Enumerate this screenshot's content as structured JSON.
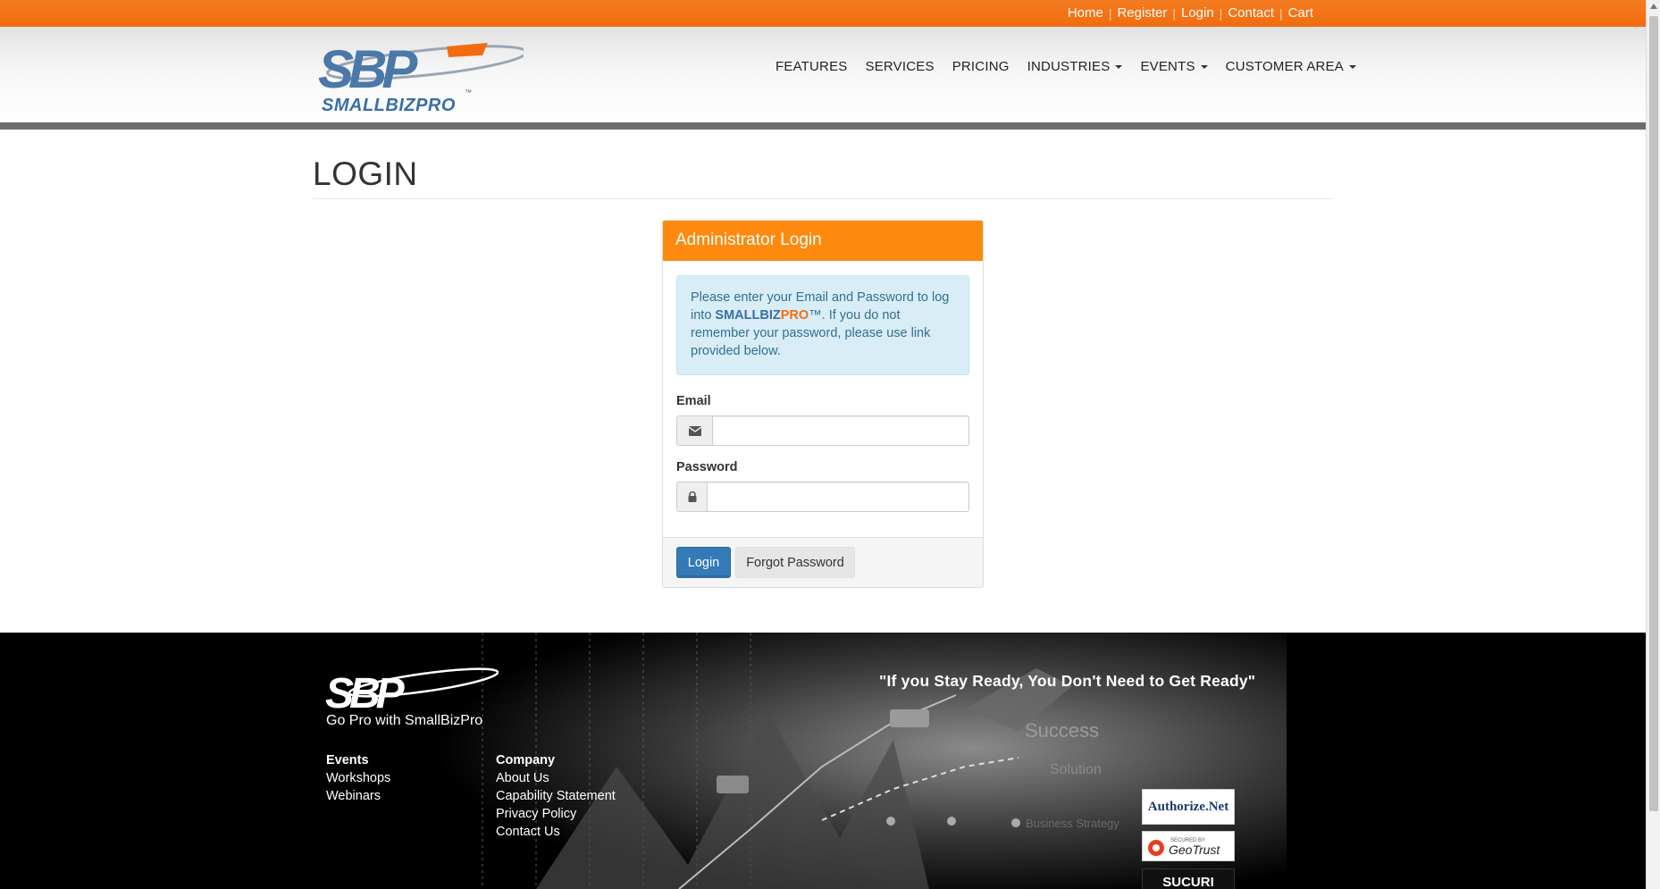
{
  "topbar": {
    "links": [
      {
        "label": "Home"
      },
      {
        "label": "Register"
      },
      {
        "label": "Login"
      },
      {
        "label": "Contact"
      },
      {
        "label": "Cart"
      }
    ]
  },
  "brand": {
    "logo_text": "SBP",
    "logo_sub": "SMALLBIZPRO"
  },
  "nav": {
    "items": [
      {
        "label": "FEATURES"
      },
      {
        "label": "SERVICES"
      },
      {
        "label": "PRICING"
      },
      {
        "label": "INDUSTRIES"
      },
      {
        "label": "EVENTS"
      },
      {
        "label": "CUSTOMER AREA"
      }
    ]
  },
  "page": {
    "title": "LOGIN"
  },
  "panel": {
    "title": "Administrator Login",
    "alert_prefix": "Please enter your Email and Password to log into ",
    "alert_brand_a": "SMALLBIZ",
    "alert_brand_b": "PRO",
    "alert_suffix": "™. If you do not remember your password, please use link provided below.",
    "email_label": "Email",
    "email_value": "",
    "password_label": "Password",
    "password_value": "",
    "login_button": "Login",
    "forgot_button": "Forgot Password"
  },
  "footer": {
    "logo_text": "SBP",
    "tagline": "Go Pro with SmallBizPro",
    "quote": "\"If you Stay Ready, You Don't Need to Get Ready\"",
    "events": {
      "heading": "Events",
      "links": [
        "Workshops",
        "Webinars"
      ]
    },
    "company": {
      "heading": "Company",
      "links": [
        "About Us",
        "Capability Statement",
        "Privacy Policy",
        "Contact Us"
      ]
    },
    "badges": {
      "authorize": "Authorize.Net",
      "geotrust_small": "SECURED BY",
      "geotrust": "GeoTrust",
      "sucuri": "SUCURI"
    },
    "bg_words": [
      "Success",
      "Solution",
      "Business Strategy"
    ]
  },
  "colors": {
    "accent_orange": "#f47c20",
    "panel_orange": "#fd8a0f",
    "primary_blue": "#337ab7",
    "brand_blue": "#3a6ea5"
  }
}
